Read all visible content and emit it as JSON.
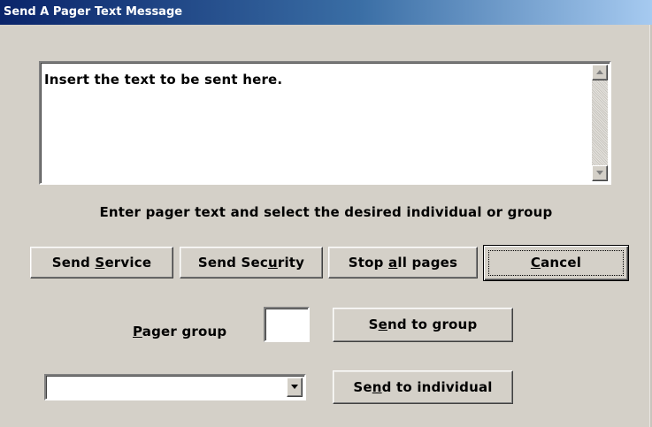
{
  "window": {
    "title": "Send A Pager Text Message"
  },
  "message": {
    "value": "Insert the text to be sent here."
  },
  "instruction": "Enter pager text and select the desired individual or group",
  "buttons": {
    "send_service": {
      "pre": "Send ",
      "key": "S",
      "post": "ervice"
    },
    "send_security": {
      "pre": "Send Sec",
      "key": "u",
      "post": "rity"
    },
    "stop_all": {
      "pre": "Stop ",
      "key": "a",
      "post": "ll pages"
    },
    "cancel": {
      "pre": "",
      "key": "C",
      "post": "ancel"
    },
    "send_group": {
      "pre": "S",
      "key": "e",
      "post": "nd to group"
    },
    "send_individual": {
      "pre": "Se",
      "key": "n",
      "post": "d to individual"
    }
  },
  "pager_group": {
    "label_key": "P",
    "label_rest": "ager group",
    "value": ""
  },
  "individual": {
    "selected": ""
  },
  "icons": {
    "scroll_up": "triangle-up",
    "scroll_down": "triangle-down",
    "dropdown": "triangle-down"
  }
}
